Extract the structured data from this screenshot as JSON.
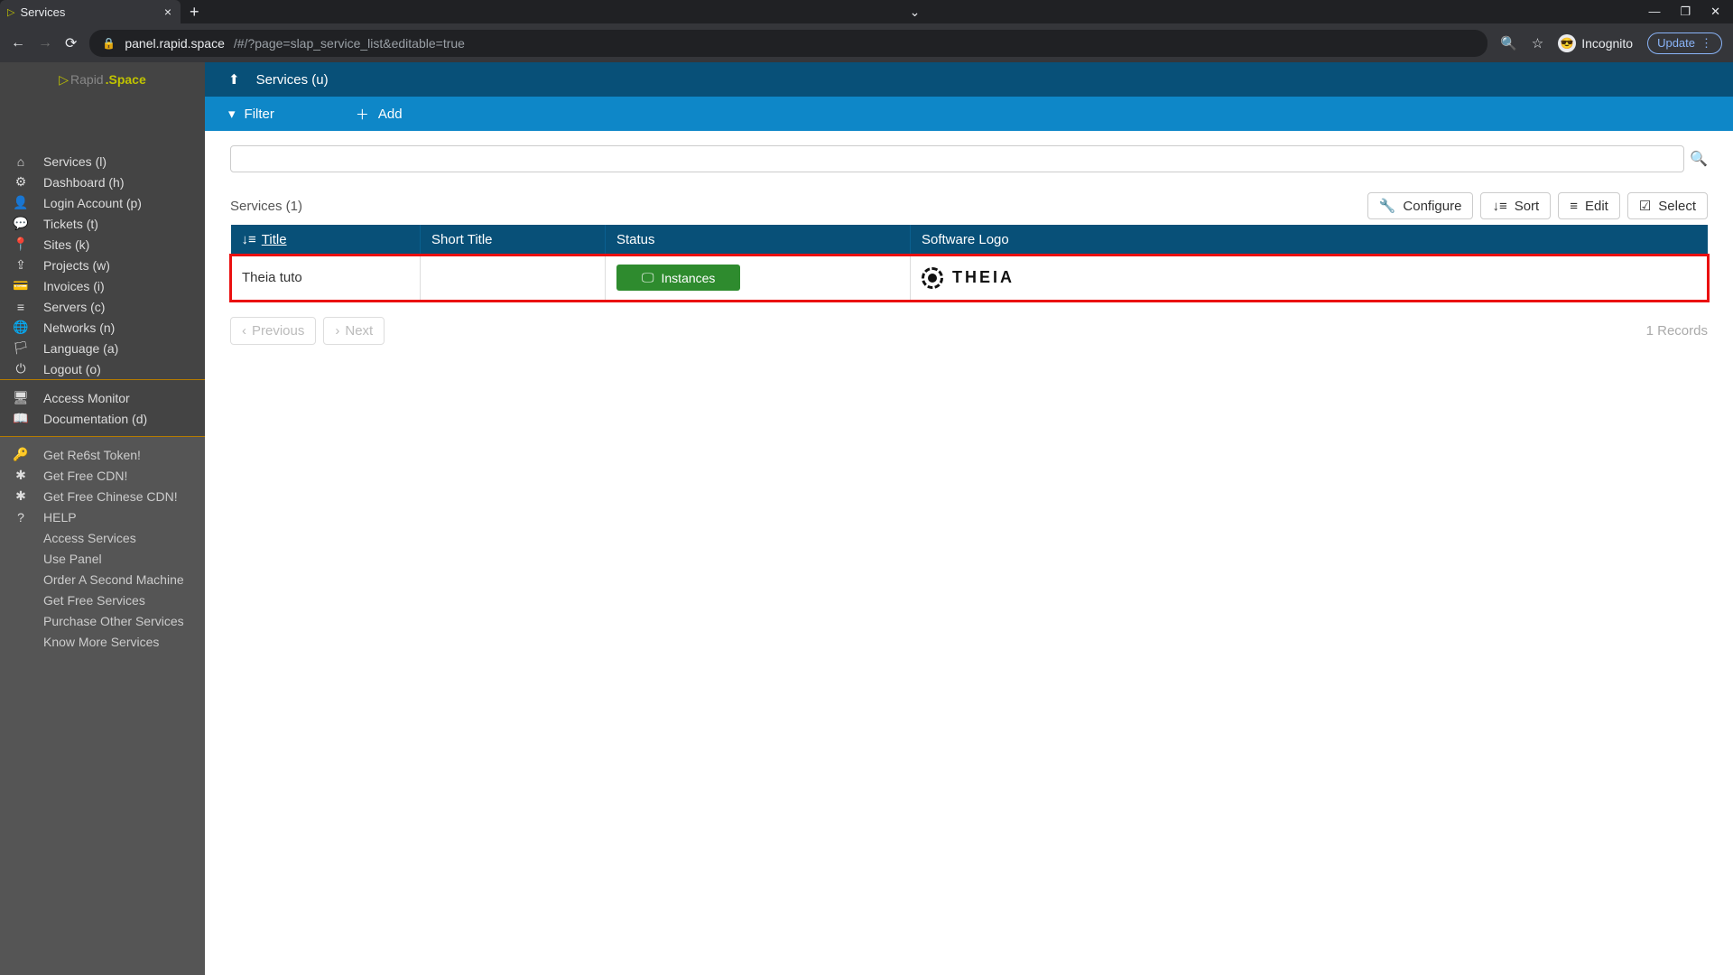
{
  "browser": {
    "tab_title": "Services",
    "url_host": "panel.rapid.space",
    "url_path": "/#/?page=slap_service_list&editable=true",
    "incognito_label": "Incognito",
    "update_label": "Update"
  },
  "brand": {
    "rapid": "Rapid",
    "space": ".Space"
  },
  "sidebar": {
    "main": [
      {
        "icon": "⌂",
        "label": "Services (l)"
      },
      {
        "icon": "⚙",
        "label": "Dashboard (h)"
      },
      {
        "icon": "👤",
        "label": "Login Account (p)"
      },
      {
        "icon": "💬",
        "label": "Tickets (t)"
      },
      {
        "icon": "📍",
        "label": "Sites (k)"
      },
      {
        "icon": "⇪",
        "label": "Projects (w)"
      },
      {
        "icon": "💳",
        "label": "Invoices (i)"
      },
      {
        "icon": "≡",
        "label": "Servers (c)"
      },
      {
        "icon": "🌐",
        "label": "Networks (n)"
      },
      {
        "icon": "🏳",
        "label": "Language (a)"
      },
      {
        "icon": "⏻",
        "label": "Logout (o)"
      }
    ],
    "secondary": [
      {
        "icon": "🖥",
        "label": "Access Monitor"
      },
      {
        "icon": "📖",
        "label": "Documentation (d)"
      }
    ],
    "tertiary": [
      {
        "icon": "🔑",
        "label": "Get Re6st Token!"
      },
      {
        "icon": "✱",
        "label": "Get Free CDN!"
      },
      {
        "icon": "✱",
        "label": "Get Free Chinese CDN!"
      },
      {
        "icon": "?",
        "label": "HELP"
      },
      {
        "icon": "",
        "label": "Access Services"
      },
      {
        "icon": "",
        "label": "Use Panel"
      },
      {
        "icon": "",
        "label": "Order A Second Machine"
      },
      {
        "icon": "",
        "label": "Get Free Services"
      },
      {
        "icon": "",
        "label": "Purchase Other Services"
      },
      {
        "icon": "",
        "label": "Know More Services"
      }
    ]
  },
  "header": {
    "title": "Services (u)"
  },
  "actions": {
    "filter": "Filter",
    "add": "Add"
  },
  "search": {
    "placeholder": ""
  },
  "list": {
    "label": "Services (1)",
    "tools": {
      "configure": "Configure",
      "sort": "Sort",
      "edit": "Edit",
      "select": "Select"
    },
    "columns": {
      "title": "Title",
      "short_title": "Short Title",
      "status": "Status",
      "logo": "Software Logo"
    },
    "rows": [
      {
        "title": "Theia tuto",
        "short_title": "",
        "status_label": "Instances",
        "logo_text": "THEIA"
      }
    ]
  },
  "pager": {
    "prev": "Previous",
    "next": "Next",
    "records": "1 Records"
  }
}
